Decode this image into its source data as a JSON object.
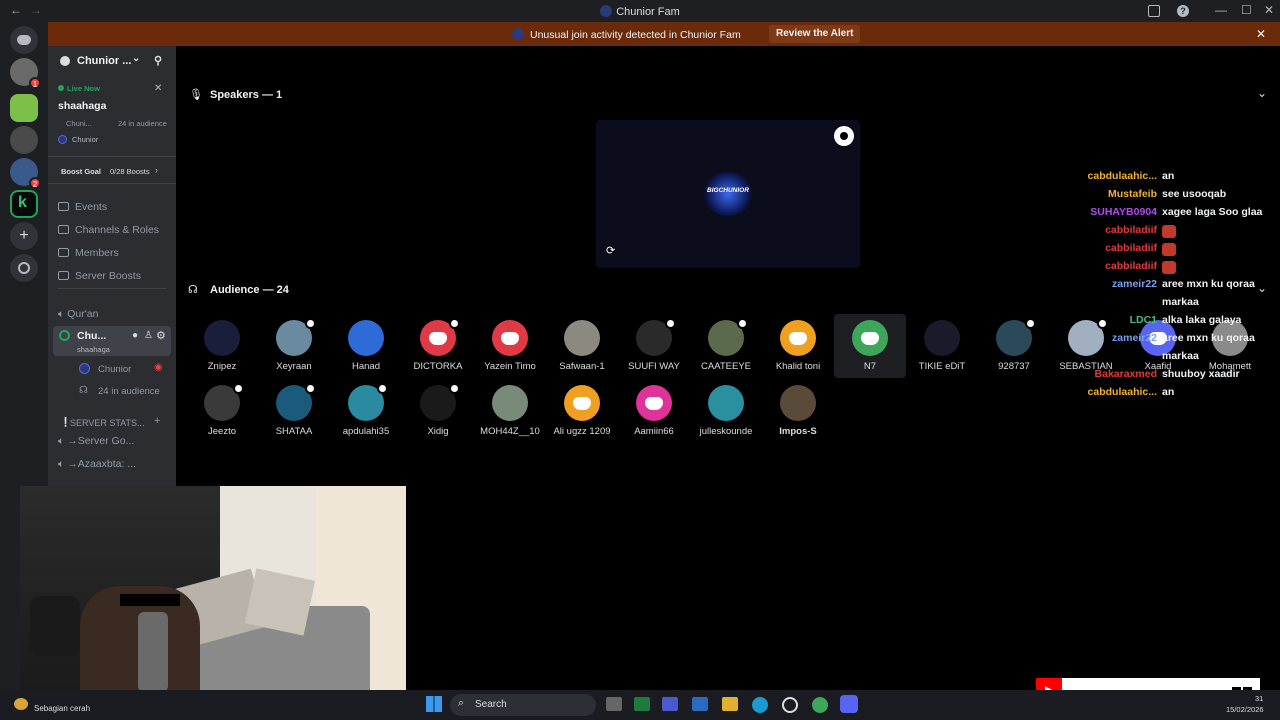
{
  "window": {
    "title": "Chunior Fam"
  },
  "alert": {
    "text": "Unusual join activity detected in Chunior Fam",
    "button": "Review the Alert"
  },
  "sidebar": {
    "server_name": "Chunior ...",
    "live": {
      "badge": "Live Now",
      "title": "shaahaga",
      "meta": "Chuni...",
      "audience": "24 in audience",
      "host": "Chunior"
    },
    "boost": {
      "label": "Boost Goal",
      "progress": "0/28 Boosts"
    },
    "menu": [
      "Events",
      "Channels & Roles",
      "Members",
      "Server Boosts"
    ],
    "channels": {
      "quran": "Qur'an",
      "stage_name": "Chu...",
      "stage_sub": "shaahaga",
      "stage_host": "Chunior",
      "stage_audience": "24 in audience",
      "category": "SERVER STATS...",
      "stat1": "→Server Go...",
      "stat2": "→Azaaxbta: ..."
    }
  },
  "main": {
    "speakers_header": "Speakers — 1",
    "audience_header": "Audience — 24",
    "stage_logo": "BIGCHUNIOR",
    "audience_row1": [
      "Znipez",
      "Xeyraan",
      "Hanad",
      "DICTORKA",
      "Yazein Timo",
      "Safwaan-1",
      "SUUFI WAY",
      "CAATEEYE",
      "Khalid toni",
      "N7",
      "TIKIE eDiT",
      "928737",
      "SEBASTIAN",
      "Xaafid",
      "Mohamett"
    ],
    "audience_row2": [
      "Jeezto",
      "SHATAA",
      "apdulahi35",
      "Xidig",
      "MOH44Z__10",
      "Ali ugzz 1209",
      "Aamiin66",
      "julleskounde",
      "Impos-S"
    ]
  },
  "chat": [
    {
      "user": "cabdulaahic...",
      "msg": "an",
      "color": "#f0b232"
    },
    {
      "user": "Mustafeib",
      "msg": "see usooqab",
      "color": "#f0b232"
    },
    {
      "user": "SUHAYB0904",
      "msg": "xagee laga Soo glaa",
      "color": "#b04cf0"
    },
    {
      "user": "cabbiladiif",
      "msg": "",
      "color": "#e03a3a"
    },
    {
      "user": "cabbiladiif",
      "msg": "",
      "color": "#e03a3a"
    },
    {
      "user": "cabbiladiif",
      "msg": "",
      "color": "#e03a3a"
    },
    {
      "user": "zameir22",
      "msg": "aree mxn ku qoraa",
      "color": "#7aa0f0"
    },
    {
      "user": "",
      "msg": "markaa",
      "color": "#7aa0f0"
    },
    {
      "user": "LDC1",
      "msg": "alka laka galaya",
      "color": "#3ec07a"
    },
    {
      "user": "zameir22",
      "msg": "aree mxn ku qoraa",
      "color": "#7aa0f0"
    },
    {
      "user": "",
      "msg": "markaa",
      "color": "#7aa0f0"
    },
    {
      "user": "Bakaraxmed",
      "msg": "shuuboy xaadir",
      "color": "#e03a3a"
    },
    {
      "user": "cabdulaahic...",
      "msg": "an",
      "color": "#f0b232"
    }
  ],
  "taskbar": {
    "weather": "Sebagian cerah",
    "search": "Search",
    "time": "31",
    "date": "15/02/2026"
  },
  "colors": {
    "accent": "#5865f2",
    "alert_bg": "#6b2b0a",
    "sidebar_bg": "#2b2d31",
    "rail_bg": "#1e1f22"
  }
}
